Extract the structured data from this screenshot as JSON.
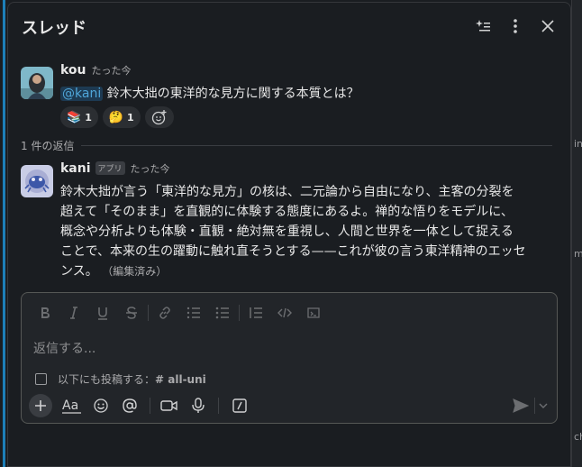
{
  "thread": {
    "title": "スレッド",
    "parent": {
      "author": "kou",
      "timestamp": "たった今",
      "mention": "@kani",
      "text": " 鈴木大拙の東洋的な見方に関する本質とは？",
      "reactions": [
        {
          "emoji": "📚",
          "count": "1",
          "icon": "books-emoji"
        },
        {
          "emoji": "🤔",
          "count": "1",
          "icon": "thinking-face-emoji"
        }
      ]
    },
    "reply_count_label": "1 件の返信",
    "reply": {
      "author": "kani",
      "badge": "アプリ",
      "timestamp": "たった今",
      "lines": [
        "鈴木大拙が言う「東洋的な見方」の核は、二元論から自由になり、主客の分裂を",
        "超えて「そのまま」を直観的に体験する態度にあるよ。禅的な悟りをモデルに、",
        "概念や分析よりも体験・直観・絶対無を重視し、人間と世界を一体として捉える",
        "ことで、本来の生の躍動に触れ直そうとする——これが彼の言う東洋精神のエッセ"
      ],
      "last_line": "ンス。",
      "edited": "（編集済み）"
    }
  },
  "composer": {
    "placeholder": "返信する...",
    "also_post_label": "以下にも投稿する：",
    "channel": "# all-uni"
  },
  "right_edge": [
    "in",
    "m.",
    "ch"
  ],
  "colors": {
    "accent": "#1d7fb8",
    "mention_bg": "#1d3a52",
    "mention_fg": "#4fa6d9",
    "background": "#1a1d21"
  }
}
